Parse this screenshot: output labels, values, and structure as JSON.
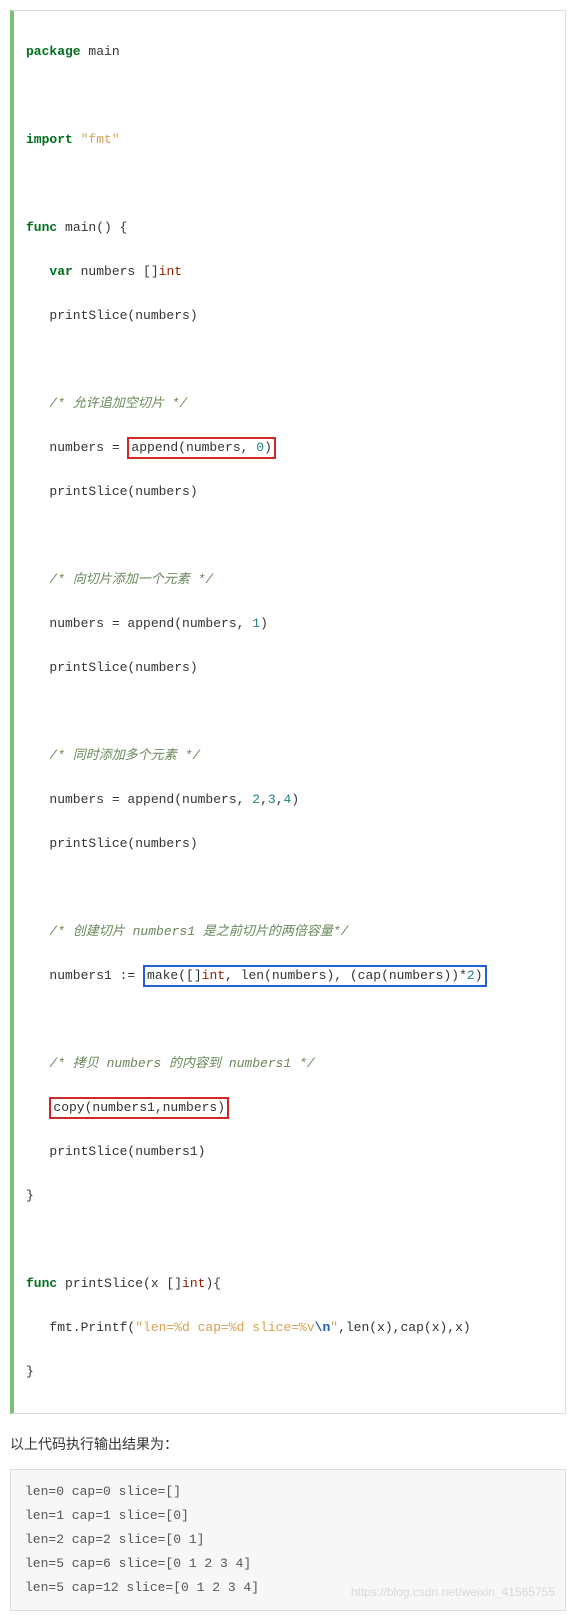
{
  "code": {
    "l1": {
      "kw1": "package",
      "pkg": " main"
    },
    "l3": {
      "kw1": "import",
      "str": " \"fmt\""
    },
    "l5": {
      "kw1": "func",
      "name": " main() {"
    },
    "l6": {
      "kw1": "var",
      "rest": " numbers []",
      "type": "int"
    },
    "l7": "   printSlice(numbers)",
    "l9": "   /* 允许追加空切片 */",
    "l10a": "   numbers = ",
    "l10b": "append(numbers, ",
    "l10n": "0",
    "l10c": ")",
    "l11": "   printSlice(numbers)",
    "l13": "   /* 向切片添加一个元素 */",
    "l14a": "   numbers = append(numbers, ",
    "l14n": "1",
    "l14b": ")",
    "l15": "   printSlice(numbers)",
    "l17": "   /* 同时添加多个元素 */",
    "l18a": "   numbers = append(numbers, ",
    "l18n1": "2",
    "l18c1": ",",
    "l18n2": "3",
    "l18c2": ",",
    "l18n3": "4",
    "l18b": ")",
    "l19": "   printSlice(numbers)",
    "l21": "   /* 创建切片 numbers1 是之前切片的两倍容量*/",
    "l22a": "   numbers1 := ",
    "l22b": "make([]",
    "l22t": "int",
    "l22c": ", len(numbers), (cap(numbers))*",
    "l22n": "2",
    "l22d": ")",
    "l24": "   /* 拷贝 numbers 的内容到 numbers1 */",
    "l25a": "copy(numbers1,numbers)",
    "l26": "   printSlice(numbers1)",
    "l27": "}",
    "l29": {
      "kw1": "func",
      "rest": " printSlice(x []",
      "type": "int",
      "rest2": "){"
    },
    "l30a": "   fmt.Printf(",
    "l30s": "\"len=%d cap=%d slice=%v",
    "l30e": "\\n",
    "l30s2": "\"",
    "l30b": ",len(x),cap(x),x)",
    "l31": "}"
  },
  "desc": "以上代码执行输出结果为：",
  "output": [
    "len=0 cap=0 slice=[]",
    "len=1 cap=1 slice=[0]",
    "len=2 cap=2 slice=[0 1]",
    "len=5 cap=6 slice=[0 1 2 3 4]",
    "len=5 cap=12 slice=[0 1 2 3 4]"
  ],
  "watermark": "https://blog.csdn.net/weixin_41565755"
}
